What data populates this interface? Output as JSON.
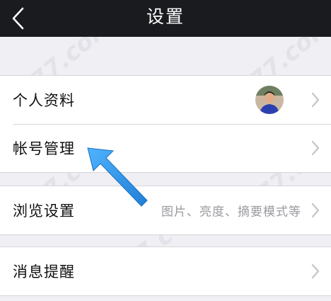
{
  "navbar": {
    "title": "设置",
    "back_icon": "chevron-left-icon"
  },
  "groups": [
    {
      "items": [
        {
          "label": "个人资料",
          "value": "",
          "has_avatar": true
        },
        {
          "label": "帐号管理",
          "value": "",
          "has_avatar": false
        }
      ]
    },
    {
      "items": [
        {
          "label": "浏览设置",
          "value": "图片、亮度、摘要模式等",
          "has_avatar": false
        }
      ]
    },
    {
      "items": [
        {
          "label": "消息提醒",
          "value": "",
          "has_avatar": false
        }
      ]
    }
  ],
  "watermark_text": "5577.com",
  "colors": {
    "navbar_bg": "#1a1b1f",
    "page_bg": "#f0eff4",
    "arrow": "#2f9bf0",
    "chevron": "#c7c7cc",
    "secondary_text": "#9a9a9f"
  }
}
